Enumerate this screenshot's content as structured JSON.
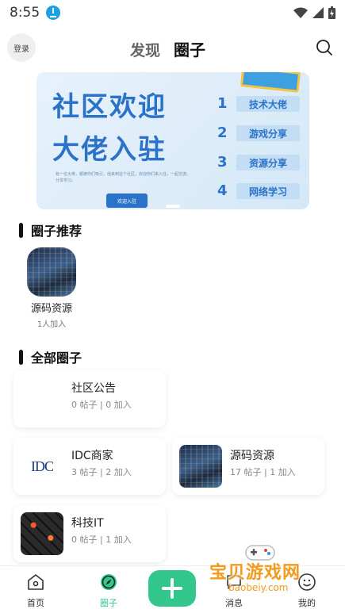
{
  "status_bar": {
    "time": "8:55"
  },
  "header": {
    "login_label": "登录",
    "tabs": [
      {
        "label": "发现"
      },
      {
        "label": "圈子"
      }
    ]
  },
  "banner": {
    "title_line1": "社区欢迎",
    "title_line2": "大佬入驻",
    "description": "有一位大佬，都被你们吸引，他来到这个社区，欢迎你们来入住，一起交流、分享学习。",
    "button_label": "欢迎入驻",
    "items": [
      {
        "num": "1",
        "label": "技术大佬"
      },
      {
        "num": "2",
        "label": "游戏分享"
      },
      {
        "num": "3",
        "label": "资源分享"
      },
      {
        "num": "4",
        "label": "网络学习"
      }
    ]
  },
  "recommended": {
    "title": "圈子推荐",
    "items": [
      {
        "name": "源码资源",
        "count": "1人加入"
      }
    ]
  },
  "all_circles": {
    "title": "全部圈子",
    "items": [
      {
        "name": "社区公告",
        "stats": "0 帖子 | 0 加入"
      },
      {
        "name": "IDC商家",
        "stats": "3 帖子 | 2 加入",
        "thumb_text": "IDC"
      },
      {
        "name": "源码资源",
        "stats": "17 帖子 | 1 加入"
      },
      {
        "name": "科技IT",
        "stats": "0 帖子 | 1 加入"
      }
    ]
  },
  "bottom_nav": {
    "items": [
      {
        "label": "首页"
      },
      {
        "label": "圈子"
      },
      {
        "label": "消息"
      },
      {
        "label": "我的"
      }
    ]
  },
  "watermark": {
    "text": "宝贝游戏网",
    "url": "baobeiy.com"
  },
  "colors": {
    "accent": "#34c78d",
    "banner_blue": "#2a73c8",
    "active_tab": "#34c78d"
  }
}
